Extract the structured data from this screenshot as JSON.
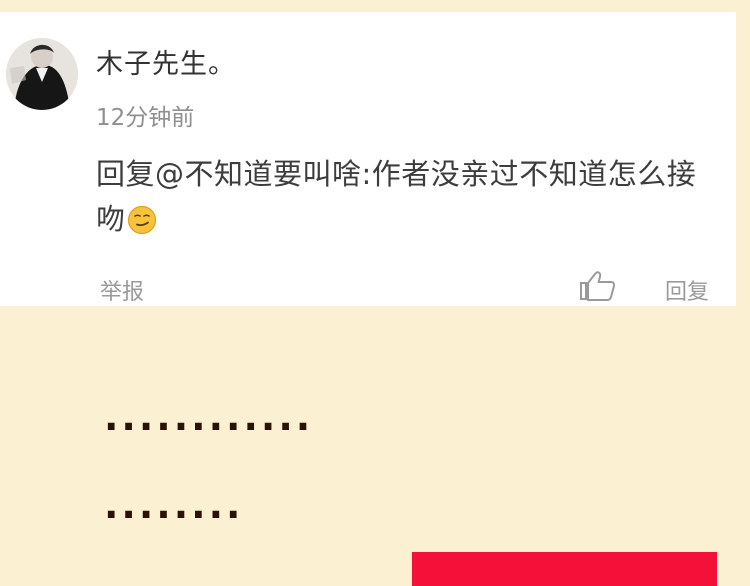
{
  "comment": {
    "username": "木子先生。",
    "timestamp": "12分钟前",
    "reply_text": "回复@不知道要叫啥:作者没亲过不知道怎么接吻",
    "emoji_icon": "smirk-emoji-icon",
    "actions": {
      "report_label": "举报",
      "like_icon": "thumbs-up-icon",
      "reply_label": "回复"
    }
  },
  "panel_text": {
    "line1": "............",
    "line2": "........"
  },
  "colors": {
    "background": "#fcf0d2",
    "card": "#ffffff",
    "dots": "#2a1208",
    "red_block": "#f5103a"
  }
}
